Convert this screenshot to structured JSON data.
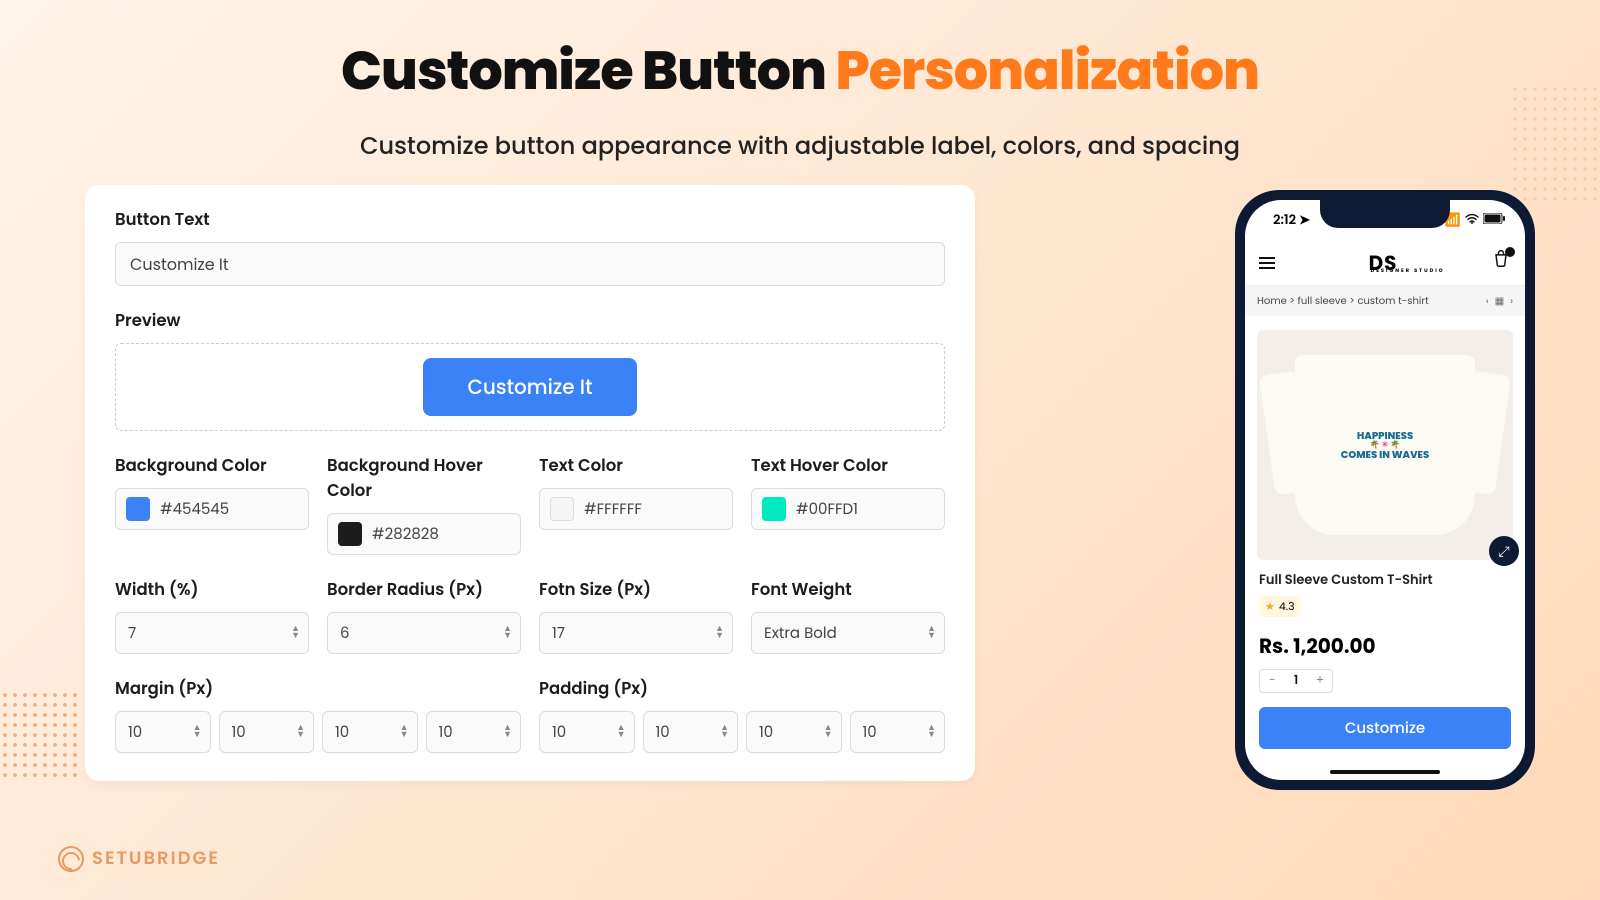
{
  "header": {
    "title_part1": "Customize Button ",
    "title_part2": "Personalization",
    "subtitle": "Customize button appearance with adjustable label, colors, and spacing"
  },
  "form": {
    "button_text": {
      "label": "Button Text",
      "value": "Customize It"
    },
    "preview": {
      "label": "Preview",
      "button": "Customize It"
    },
    "bg_color": {
      "label": "Background Color",
      "value": "#454545",
      "swatch": "#3b82f6"
    },
    "bg_hover_color": {
      "label": "Background Hover Color",
      "value": "#282828",
      "swatch": "#1c1c1c"
    },
    "text_color": {
      "label": "Text Color",
      "value": "#FFFFFF",
      "swatch": "#f5f5f5"
    },
    "text_hover_color": {
      "label": "Text Hover Color",
      "value": "#00FFD1",
      "swatch": "#00e9bf"
    },
    "width": {
      "label": "Width (%)",
      "value": "7"
    },
    "border_radius": {
      "label": "Border Radius (Px)",
      "value": "6"
    },
    "font_size": {
      "label": "Fotn Size (Px)",
      "value": "17"
    },
    "font_weight": {
      "label": "Font Weight",
      "value": "Extra Bold"
    },
    "margin": {
      "label": "Margin (Px)",
      "values": [
        "10",
        "10",
        "10",
        "10"
      ]
    },
    "padding": {
      "label": "Padding (Px)",
      "values": [
        "10",
        "10",
        "10",
        "10"
      ]
    }
  },
  "phone": {
    "time": "2:12",
    "store_name": "DS",
    "store_sub": "DESIGNER STUDIO",
    "breadcrumb": "Home > full sleeve > custom t-shirt",
    "graphic_line1": "HAPPINESS",
    "graphic_line2": "COMES IN WAVES",
    "product_title": "Full Sleeve Custom T-Shirt",
    "rating": "4.3",
    "price": "Rs. 1,200.00",
    "qty": "1",
    "customize_btn": "Customize"
  },
  "brand": "SETUBRIDGE"
}
